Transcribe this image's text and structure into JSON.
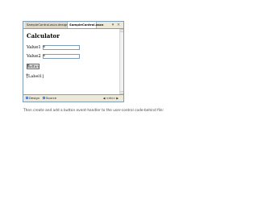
{
  "window": {
    "tabs": [
      {
        "label": "SampleControl.ascx.designer.cs"
      },
      {
        "label": "SampleControl.ascx"
      }
    ],
    "control_icons": {
      "dropdown": "▾",
      "close": "×"
    }
  },
  "designer": {
    "title": "Calculator",
    "value1_label": "Value1",
    "value2_label": "Value2",
    "button_label": "Button",
    "label_text": "[Label1]",
    "glyph": "⊕"
  },
  "bottom": {
    "design_tab": "Design",
    "source_tab": "Source",
    "breadcrumb": "◀ <div> ▶"
  },
  "caption": "Then create and add a button event-handler to the user-control code-behind file:"
}
